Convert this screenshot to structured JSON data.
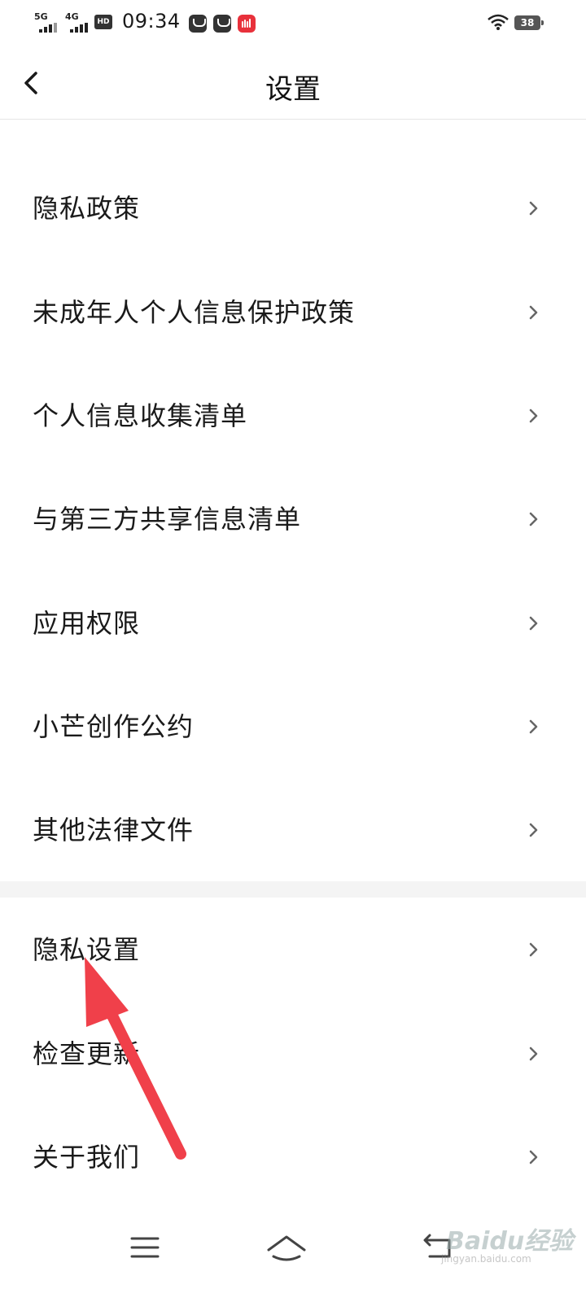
{
  "status_bar": {
    "signal_1": "5G",
    "signal_2": "4G",
    "hd_label": "HD",
    "time": "09:34",
    "battery": "38",
    "icons": [
      "signal-icon",
      "signal-icon",
      "hd-icon",
      "mail-icon",
      "mail-icon",
      "app-icon",
      "wifi-icon",
      "battery-icon"
    ]
  },
  "header": {
    "title": "设置",
    "back_icon": "chevron-left-icon"
  },
  "settings": {
    "group1": [
      {
        "label": "隐私政策"
      },
      {
        "label": "未成年人个人信息保护政策"
      },
      {
        "label": "个人信息收集清单"
      },
      {
        "label": "与第三方共享信息清单"
      },
      {
        "label": "应用权限"
      },
      {
        "label": "小芒创作公约"
      },
      {
        "label": "其他法律文件"
      }
    ],
    "group2": [
      {
        "label": "隐私设置"
      },
      {
        "label": "检查更新"
      },
      {
        "label": "关于我们"
      }
    ]
  },
  "nav_bar": {
    "icons": [
      "menu-icon",
      "home-icon",
      "back-icon"
    ]
  },
  "watermark": {
    "brand": "Baidu经验",
    "url": "jingyan.baidu.com"
  },
  "colors": {
    "annotation_arrow": "#f0404a",
    "divider": "#f4f4f4",
    "text": "#1a1a1a",
    "chevron": "#666666"
  }
}
